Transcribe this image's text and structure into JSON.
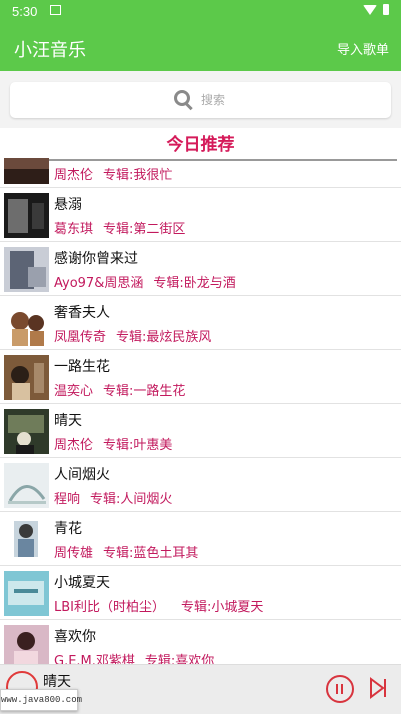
{
  "status_bar": {
    "time": "5:30",
    "sim_icon": "sim-card-icon",
    "wifi_icon": "wifi-icon",
    "battery_icon": "battery-icon"
  },
  "app_bar": {
    "title": "小汪音乐",
    "import_label": "导入歌单"
  },
  "search": {
    "placeholder": "搜索",
    "icon": "search-icon"
  },
  "list": {
    "header": "今日推荐",
    "songs": [
      {
        "title": "",
        "singer": "周杰伦",
        "album": "专辑:我很忙"
      },
      {
        "title": "悬溺",
        "singer": "葛东琪",
        "album": "专辑:第二街区"
      },
      {
        "title": "感谢你曾来过",
        "singer": "Ayo97&周思涵",
        "album": "专辑:卧龙与酒"
      },
      {
        "title": "奢香夫人",
        "singer": "凤凰传奇",
        "album": "专辑:最炫民族风"
      },
      {
        "title": "一路生花",
        "singer": "温奕心",
        "album": "专辑:一路生花"
      },
      {
        "title": "晴天",
        "singer": "周杰伦",
        "album": "专辑:叶惠美"
      },
      {
        "title": "人间烟火",
        "singer": "程响",
        "album": "专辑:人间烟火"
      },
      {
        "title": "青花",
        "singer": "周传雄",
        "album": "专辑:蓝色土耳其"
      },
      {
        "title": "小城夏天",
        "singer": "LBI利比（时柏尘）",
        "album": "专辑:小城夏天"
      },
      {
        "title": "喜欢你",
        "singer": "G.E.M.邓紫棋",
        "album": "专辑:喜欢你"
      }
    ]
  },
  "player": {
    "now_playing": "晴天",
    "pause_icon": "pause-icon",
    "next_icon": "skip-next-icon"
  },
  "watermark": "www.java800.com",
  "colors": {
    "green": "#5cc94a",
    "accent": "#c2195d",
    "header": "#d51b5a",
    "player_red": "#d8343e"
  }
}
